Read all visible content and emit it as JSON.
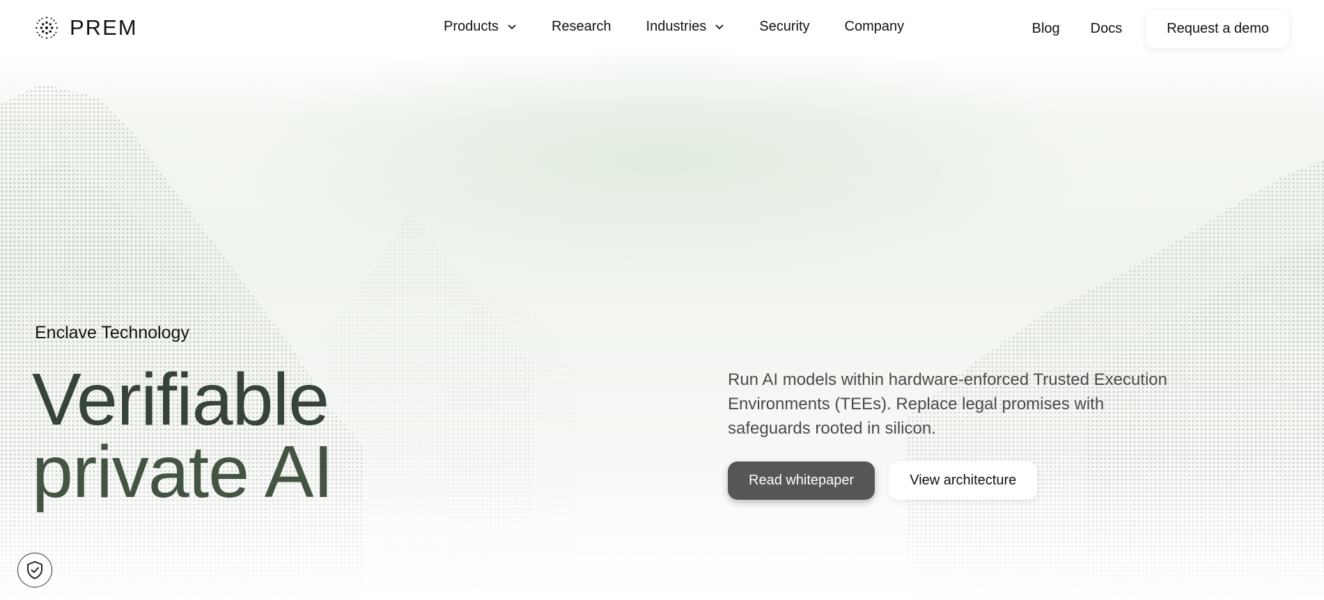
{
  "brand": {
    "name": "PREM",
    "logo_icon": "dotted-sphere-icon"
  },
  "nav": {
    "items": [
      {
        "label": "Products",
        "has_dropdown": true
      },
      {
        "label": "Research",
        "has_dropdown": false
      },
      {
        "label": "Industries",
        "has_dropdown": true
      },
      {
        "label": "Security",
        "has_dropdown": false
      },
      {
        "label": "Company",
        "has_dropdown": false
      }
    ],
    "right": {
      "blog": "Blog",
      "docs": "Docs",
      "cta": "Request a demo"
    }
  },
  "hero": {
    "eyebrow": "Enclave Technology",
    "headline_line1": "Verifiable",
    "headline_line2": "private AI",
    "description": "Run AI models within hardware-enforced Trusted Execution Environments (TEEs). Replace legal promises with safeguards rooted in silicon.",
    "primary_cta": "Read whitepaper",
    "secondary_cta": "View architecture"
  },
  "badge": {
    "icon": "shield-check-icon"
  },
  "colors": {
    "headline": "#3a4a3c",
    "primary_button": "#565656",
    "background_tint": "#eef3ec"
  }
}
